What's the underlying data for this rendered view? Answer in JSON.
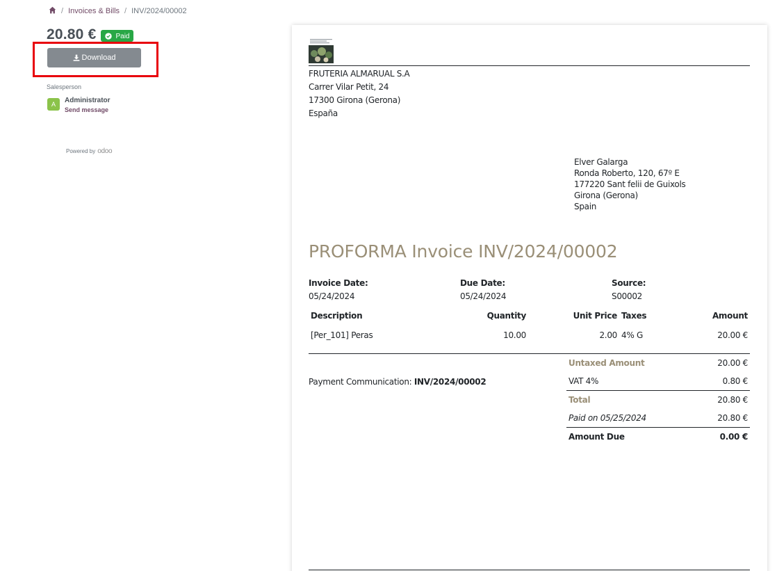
{
  "breadcrumb": {
    "home_icon": "home-icon",
    "items": [
      "Invoices & Bills",
      "INV/2024/00002"
    ]
  },
  "sidebar": {
    "amount_total": "20.80 €",
    "status": "Paid",
    "download_label": "Download",
    "salesperson_label": "Salesperson",
    "salesperson_initial": "A",
    "salesperson_name": "Administrator",
    "send_message": "Send message",
    "powered_by": "Powered by",
    "powered_by_brand": "odoo"
  },
  "document": {
    "company": {
      "name": "FRUTERIA ALMARUAL S.A",
      "street": "Carrer Vilar Petit, 24",
      "city": "17300 Girona (Gerona)",
      "country": "España"
    },
    "customer": {
      "name": "Elver Galarga",
      "street": "Ronda Roberto, 120, 67º E",
      "city": "177220 Sant felii de Guixols",
      "state": "Girona (Gerona)",
      "country": "Spain"
    },
    "title": "PROFORMA Invoice INV/2024/00002",
    "invoice_date_label": "Invoice Date:",
    "invoice_date": "05/24/2024",
    "due_date_label": "Due Date:",
    "due_date": "05/24/2024",
    "source_label": "Source:",
    "source": "S00002",
    "columns": {
      "description": "Description",
      "quantity": "Quantity",
      "unit_price": "Unit Price",
      "taxes": "Taxes",
      "amount": "Amount"
    },
    "lines": [
      {
        "description": "[Per_101] Peras",
        "quantity": "10.00",
        "unit_price": "2.00",
        "taxes": "4% G",
        "amount": "20.00 €"
      }
    ],
    "payment_comm_label": "Payment Communication:",
    "payment_comm_value": "INV/2024/00002",
    "totals": {
      "untaxed_label": "Untaxed Amount",
      "untaxed_value": "20.00 €",
      "vat_label": "VAT 4%",
      "vat_value": "0.80 €",
      "total_label": "Total",
      "total_value": "20.80 €",
      "paid_label": "Paid on 05/25/2024",
      "paid_value": "20.80 €",
      "due_label": "Amount Due",
      "due_value": "0.00 €"
    }
  },
  "colors": {
    "accent": "#9a8f77",
    "brand": "#714b67",
    "paid_badge": "#28a745",
    "download_button": "#848a90",
    "highlight": "#e8000b"
  }
}
